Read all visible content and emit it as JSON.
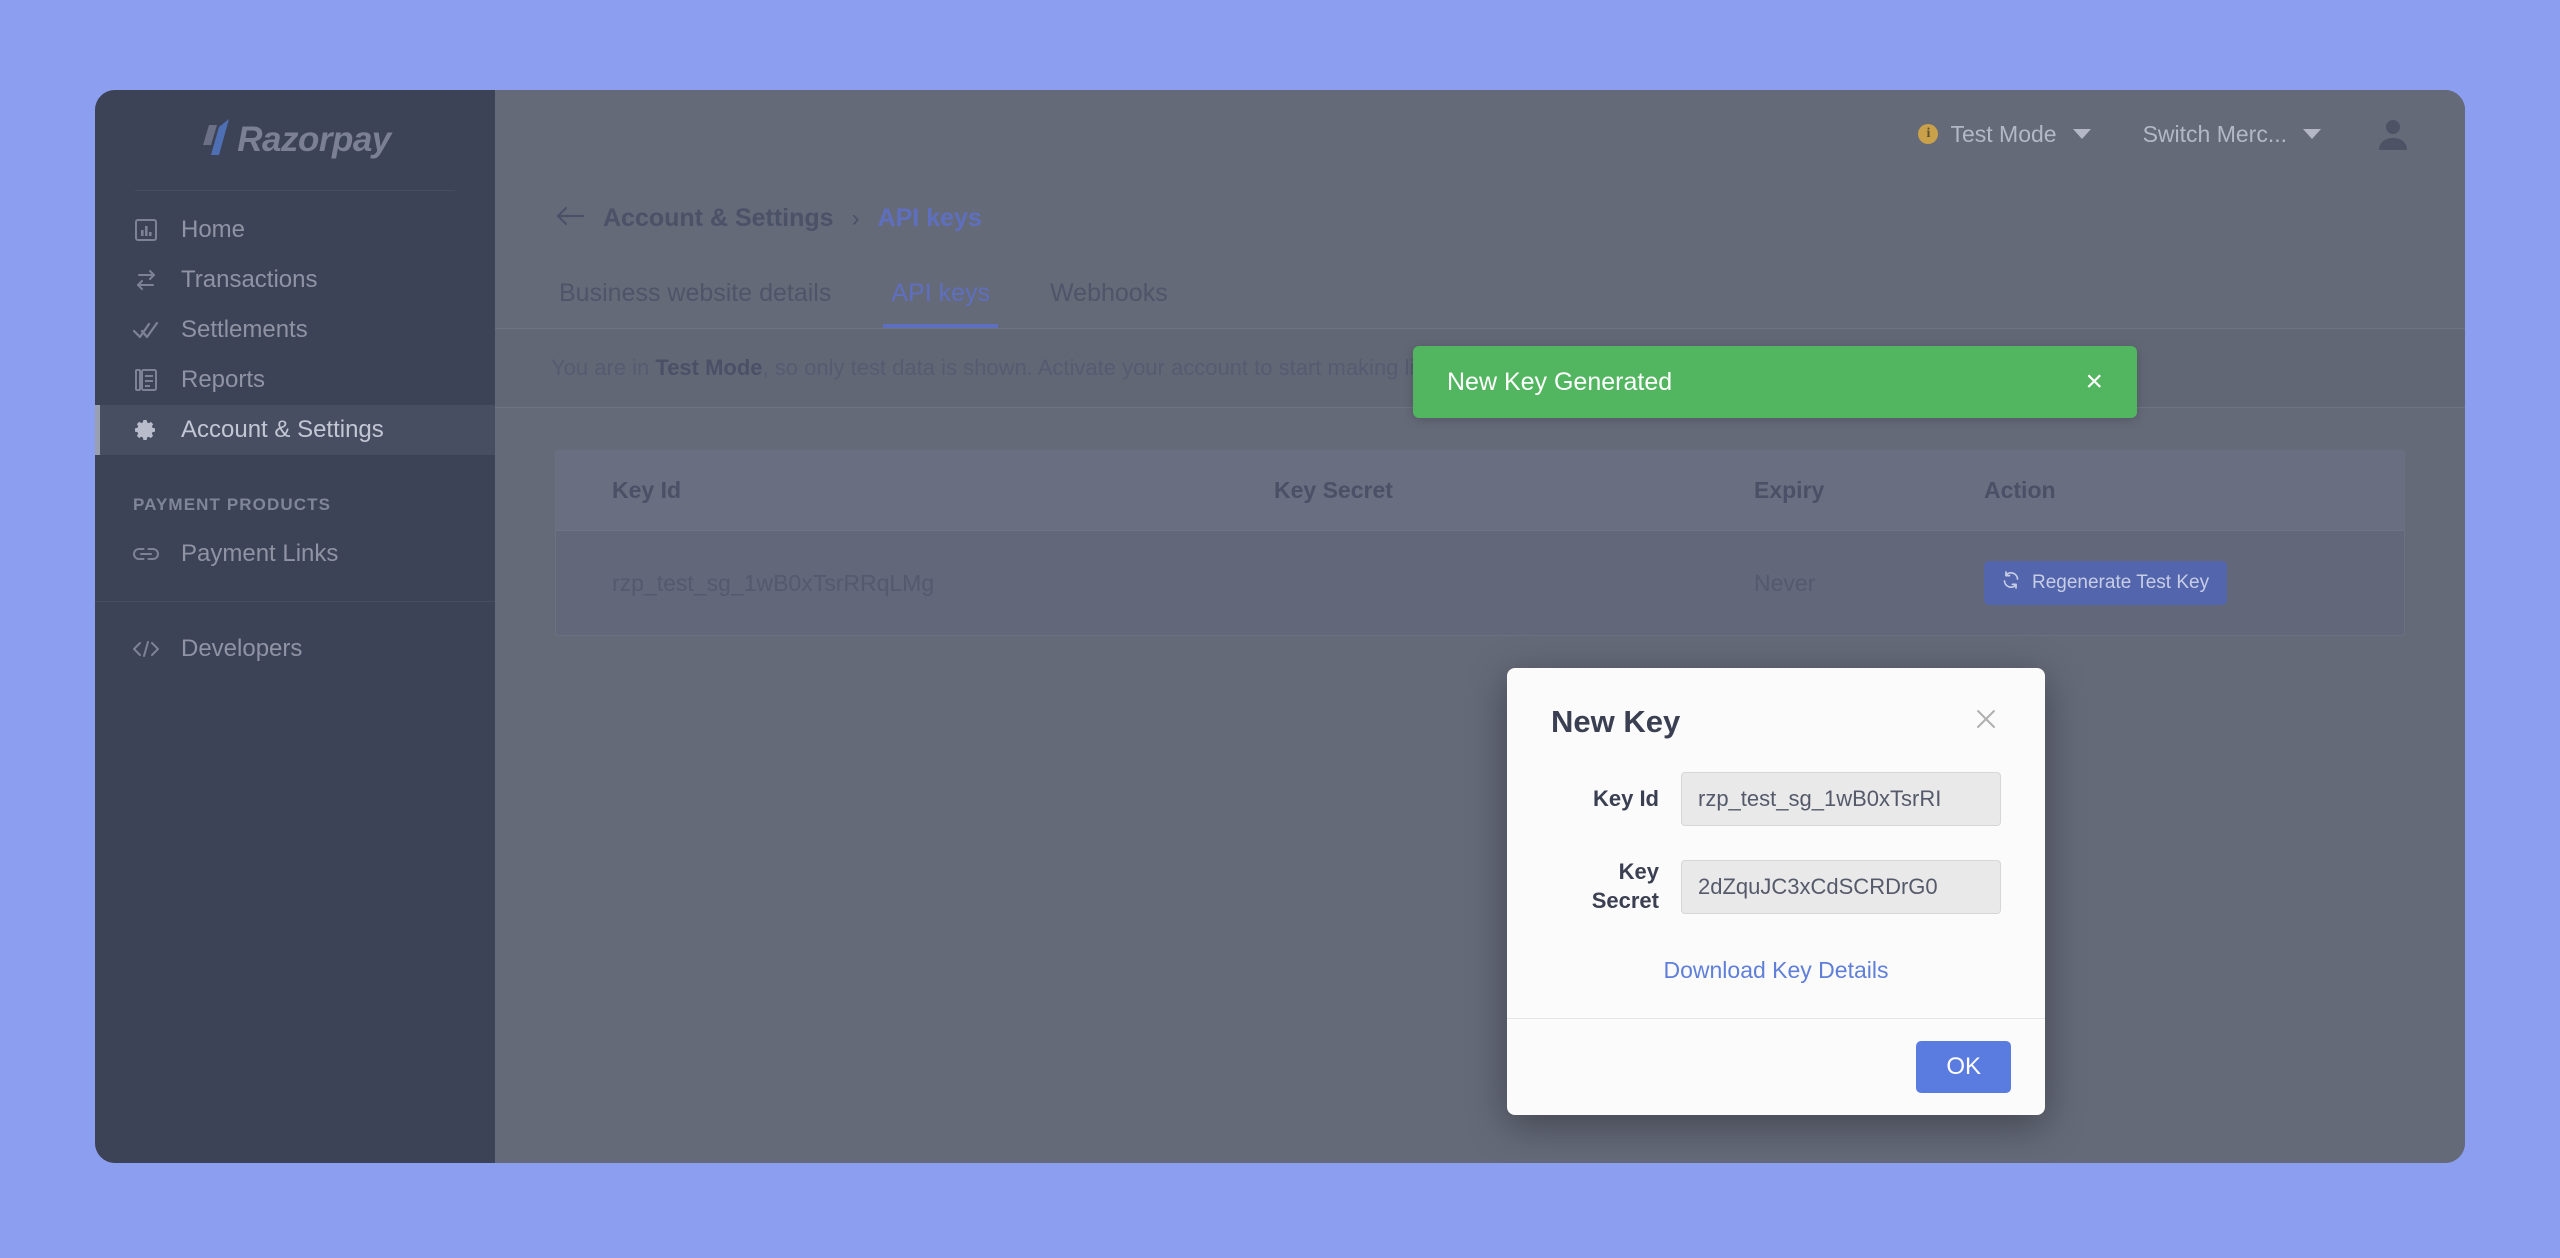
{
  "theme": {
    "page_background": "#8c9ef0",
    "sidebar_background": "#3d4356",
    "main_background": "#656a79",
    "accent_blue": "#5f6fc0",
    "toast_green": "#52b55f",
    "primary_button": "#5a7be0",
    "test_mode_dot": "#c9a14a"
  },
  "sidebar": {
    "logo_text": "Razorpay",
    "items": [
      {
        "label": "Home",
        "icon": "chart-bar-icon",
        "active": false
      },
      {
        "label": "Transactions",
        "icon": "transactions-arrows-icon",
        "active": false
      },
      {
        "label": "Settlements",
        "icon": "double-check-icon",
        "active": false
      },
      {
        "label": "Reports",
        "icon": "report-document-icon",
        "active": false
      },
      {
        "label": "Account & Settings",
        "icon": "gear-icon",
        "active": true
      }
    ],
    "section_title": "PAYMENT PRODUCTS",
    "product_items": [
      {
        "label": "Payment Links",
        "icon": "link-icon"
      }
    ],
    "footer_items": [
      {
        "label": "Developers",
        "icon": "code-brackets-icon"
      }
    ]
  },
  "topbar": {
    "test_mode_label": "Test Mode",
    "switch_merchant_label": "Switch Merc...",
    "avatar_icon": "user-avatar-icon"
  },
  "toast": {
    "message": "New Key Generated",
    "close_label": "×"
  },
  "breadcrumb": {
    "back_icon": "arrow-left-icon",
    "parent": "Account & Settings",
    "separator": "›",
    "current": "API keys"
  },
  "tabs": [
    {
      "label": "Business website details",
      "active": false
    },
    {
      "label": "API keys",
      "active": true
    },
    {
      "label": "Webhooks",
      "active": false
    }
  ],
  "test_banner": {
    "prefix": "You are in ",
    "strong": "Test Mode",
    "suffix": ", so only test data is shown. Activate your account to start making live transactions."
  },
  "table": {
    "columns": [
      "Key Id",
      "Key Secret",
      "Expiry",
      "Action"
    ],
    "rows": [
      {
        "key_id": "rzp_test_sg_1wB0xTsrRRqLMg",
        "key_secret": "",
        "expiry": "Never",
        "action_label": "Regenerate Test Key",
        "action_icon": "refresh-icon"
      }
    ]
  },
  "modal": {
    "title": "New Key",
    "close_icon": "close-icon",
    "fields": [
      {
        "label": "Key Id",
        "value": "rzp_test_sg_1wB0xTsrRI"
      },
      {
        "label": "Key Secret",
        "value": "2dZquJC3xCdSCRDrG0"
      }
    ],
    "download_link": "Download Key Details",
    "ok_label": "OK"
  }
}
